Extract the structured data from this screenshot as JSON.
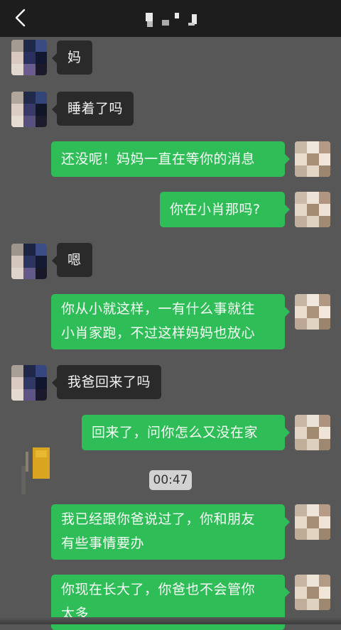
{
  "header": {
    "back_icon": "chevron-left-icon",
    "title_obscured": true
  },
  "messages": [
    {
      "side": "in",
      "text": "妈"
    },
    {
      "side": "in",
      "text": "睡着了吗"
    },
    {
      "side": "out",
      "text": "还没呢！妈妈一直在等你的消息"
    },
    {
      "side": "out",
      "text": "你在小肖那吗?"
    },
    {
      "side": "in",
      "text": "嗯"
    },
    {
      "side": "out",
      "text": "你从小就这样，一有什么事就往\n小肖家跑，不过这样妈妈也放心"
    },
    {
      "side": "in",
      "text": "我爸回来了吗"
    },
    {
      "side": "out",
      "text": "回来了，问你怎么又没在家"
    },
    {
      "side": "out",
      "text": "我已经跟你爸说过了，你和朋友\n有些事情要办"
    },
    {
      "side": "out",
      "text": "你现在长大了，你爸也不会管你\n太多"
    }
  ],
  "timestamp": "00:47",
  "colors": {
    "background": "#575757",
    "topbar": "#1d1d1d",
    "incoming_bubble": "#2a2a2a",
    "outgoing_bubble": "#2fbd58",
    "timestamp_bg": "#d2d2d2"
  }
}
